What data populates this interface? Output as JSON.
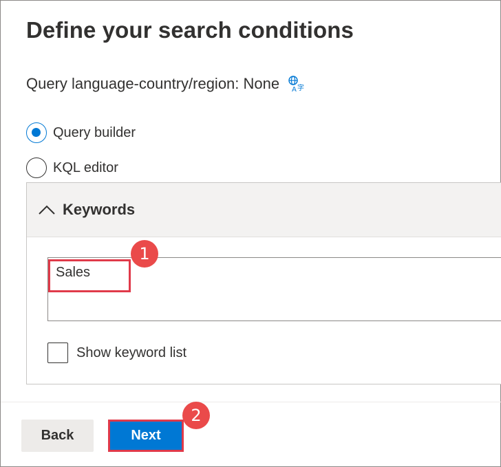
{
  "page": {
    "title": "Define your search conditions",
    "language_label": "Query language-country/region: None",
    "language_icon": "translate-icon"
  },
  "mode": {
    "options": [
      {
        "label": "Query builder",
        "selected": true
      },
      {
        "label": "KQL editor",
        "selected": false
      }
    ]
  },
  "keywords_section": {
    "header": "Keywords",
    "collapse_icon": "chevron-up-icon",
    "keywords_value": "Sales",
    "show_list_label": "Show keyword list",
    "show_list_checked": false
  },
  "annotations": {
    "step1": "1",
    "step2": "2",
    "highlight_color": "#e03a4a",
    "badge_color": "#ea4a4a"
  },
  "footer": {
    "back_label": "Back",
    "next_label": "Next"
  },
  "colors": {
    "accent": "#0078d4",
    "text": "#323130",
    "header_bg": "#f3f2f1"
  }
}
